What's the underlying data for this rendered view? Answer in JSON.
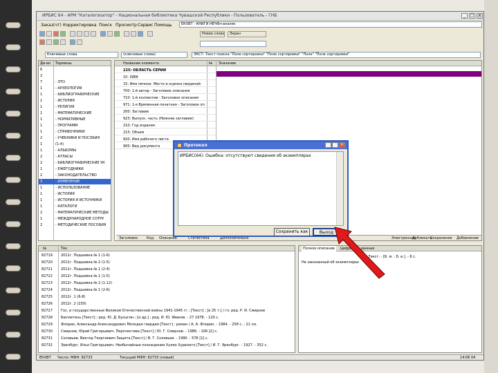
{
  "window": {
    "title": "ИРБИС 64 - АРМ \"Каталогизатор\" - Национальная библиотека Чувашской Республики - Пользователь - ГНБ",
    "min_label": "_",
    "max_label": "□",
    "close_label": "x"
  },
  "menubar": {
    "items": [
      "Заказ(чт)",
      "Корректировка",
      "Поиск",
      "Просмотр",
      "Сервис",
      "Помощь"
    ],
    "database": "ЕКХВТ - КНИГИ НЕЧФ+анализ"
  },
  "toolbar": {
    "worksheet_select": "Новое слово",
    "worksheet_btn": "Экран",
    "dict_combo": "Ключевые слова",
    "dict2_combo": "(ключевые слова)",
    "search_combo": "",
    "expression": "ЭКСТ: Текст поиска \"Поле сортировки\" \"Поле сортировки\" \"Поле\" \"Поле сортировки\""
  },
  "dictionary": {
    "headers": [
      "Ди-во",
      "Термины"
    ],
    "rows": [
      [
        "6",
        ""
      ],
      [
        "2",
        ""
      ],
      [
        "7",
        "- ЭТО"
      ],
      [
        "1",
        "- АРХЕОЛОГИЯ"
      ],
      [
        "1",
        "- БИБЛИОГРАФИЧЕСКИЕ"
      ],
      [
        "1",
        "- ИСТОРИЯ"
      ],
      [
        "1",
        "- РЕЛИГИЯ"
      ],
      [
        "1",
        "- МАТЕМАТИЧЕСКИЕ"
      ],
      [
        "1",
        "- НОРМАТИВНЫЕ"
      ],
      [
        "1",
        "- ПРОГРАММ"
      ],
      [
        "1",
        "- СПРАВОЧНИКИ"
      ],
      [
        "2",
        "- УЧЕБНИКИ И ПОСОБИЯ"
      ],
      [
        "1",
        "(1-4)"
      ],
      [
        "1",
        "- АЛЬБОМЫ"
      ],
      [
        "2",
        "- АТЛАСЫ"
      ],
      [
        "2",
        "- БИБЛИОГРАФИЧЕСКИЕ УК"
      ],
      [
        "1",
        "- ЕЖЕГОДНИКИ"
      ],
      [
        "2",
        "- ЗАКОНОДАТЕЛЬСТВО"
      ],
      [
        "3",
        "- ИЗМЕНЕНИЕ"
      ],
      [
        "1",
        "- ИСПОЛЬЗОВАНИЕ"
      ],
      [
        "1",
        "- ИСТОРИЯ"
      ],
      [
        "1",
        "- ИСТОРИЯ И ИСТОЧНИКИ"
      ],
      [
        "1",
        "- КАТАЛОГИ"
      ],
      [
        "2",
        "- МАТЕМАТИЧЕСКИЕ МЕТОДЫ"
      ],
      [
        "1",
        "- МЕЖДУНАРОДНОЕ СОТРУ"
      ],
      [
        "2",
        "- МЕТОДИЧЕСКИЕ ПОСОБИЯ"
      ]
    ],
    "selected_index": 18
  },
  "worksheet": {
    "headers": [
      "Название элемента",
      "№",
      "Значение"
    ],
    "rows": [
      "225: ОБЛАСТЬ СЕРИИ",
      "10: ISBN",
      "15: Имя личное. Место и оценка сведений",
      "700: 1-й автор - Заголовок описания",
      "710: 1-й коллектив - Заголовок описания",
      "971: 1-я Временная печатная - Заголовок описания",
      "200: Заглавие",
      "923: Выпуск, часть (Нижнее заглавие)",
      "210: Год издания",
      "215: Объем",
      "920: Имя рабочего листа",
      "900: Вид документа"
    ],
    "tabs": [
      "Заголовок",
      "Код",
      "Описание",
      "Статистика",
      "Дополнительно",
      "Электронные",
      "Дубликаты",
      "Сохранение",
      "Добавление"
    ]
  },
  "dialog": {
    "title": "Протокол",
    "message": "ИРБИС(64): Ошибка: отсутствуют сведения об экземплярах",
    "save_button": "Сохранить как",
    "exit_button": "Выход"
  },
  "records": {
    "headers": [
      "№",
      "Тек"
    ],
    "rows": [
      [
        "82719",
        "2011г. Подшивка № 1 (1-6)"
      ],
      [
        "82720",
        "2011г. Подшивка № 2 (1-5)"
      ],
      [
        "82721",
        "2011г. Подшивка № 1 (2-4)"
      ],
      [
        "82722",
        "2012г. Подшивка № 1 (1-5)"
      ],
      [
        "82723",
        "2012г. Подшивка № 2 (1-12)"
      ],
      [
        "82724",
        "2012г. Подшивка № 1 (2-6)"
      ],
      [
        "82725",
        "2012г. 1 (6-8)"
      ],
      [
        "82726",
        "2012г. 2 (230)"
      ],
      [
        "82727",
        "Гос. и государственные Великой Отечественной войны 1941-1945 гг.: [Текст] ; [в 25 т.] / гл. ред. Р. И. Смирнов"
      ],
      [
        "82728",
        "Бюллетень [Текст] ; ред. Ю. Д. Бусыгин ; [и др.] ; ред. И. Ю. Иванов. - 27 1978. - 120 с."
      ],
      [
        "82729",
        "Флорио, Александр Александрович Молодая гвардия [Текст] : роман / А. А. Флорио. - 1984. - 258 с. ; 21 см."
      ],
      [
        "82730",
        "Смирнов, Юрий Григорьевич. Перспектива [Текст] / Ю. Г. Смирнов. - 1986. - 106 [2] с."
      ],
      [
        "82731",
        "Соловьев, Виктор Георгиевич Защита [Текст] / В. Г. Соловьев. - 1990. - 576 [1] с."
      ],
      [
        "82732",
        "Эренбург, Илья Григорьевич. Необычайные похождения Хулио Хуренито [Текст] / И. Г. Эренбург. - 1927. - 352 с."
      ]
    ]
  },
  "detail": {
    "tabs": [
      "Полное описание",
      "Цифровые данные"
    ],
    "lines": [
      "Текст. - [Б. м. : б. и.]. - 6 с.",
      "Не заказанный об экземплярах"
    ]
  },
  "statusbar": {
    "db": "ЕКХВТ",
    "count": "Число: МФН: 82733",
    "current": "Текущий МФН: 82733 (новый)",
    "time": "14:06 04"
  },
  "colors": {
    "selected_row": "#800080",
    "highlight": "#3366cc",
    "arrow": "#e01a1a"
  }
}
